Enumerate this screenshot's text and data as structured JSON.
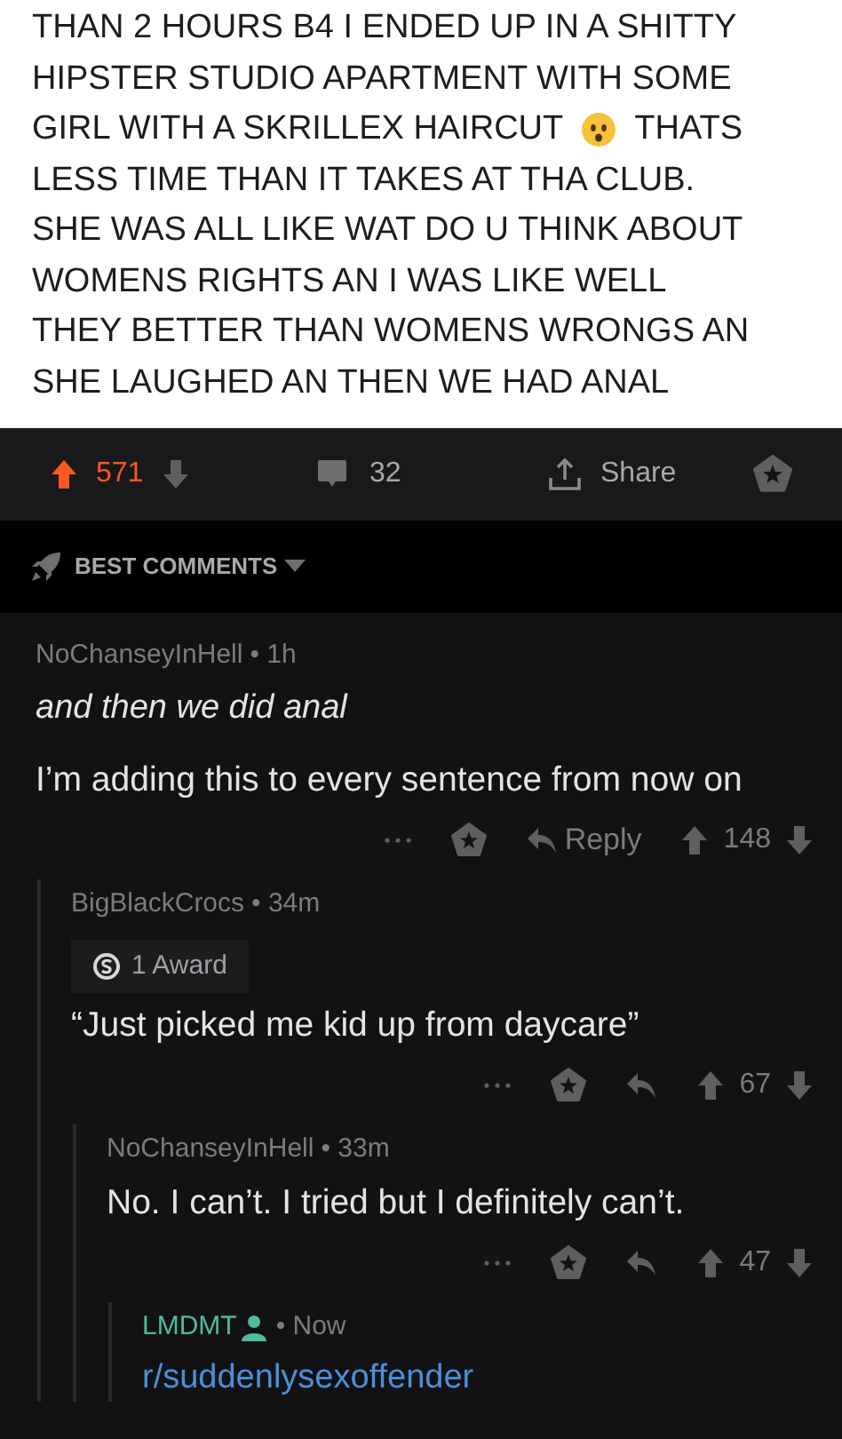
{
  "post_text": [
    {
      "text": "THAN 2 HOURS B4 I ENDED UP IN A SHITTY"
    },
    {
      "text": "HIPSTER STUDIO APARTMENT WITH SOME"
    },
    {
      "text": "GIRL WITH A SKRILLEX HAIRCUT",
      "emoji": true,
      "rest": "THATS"
    },
    {
      "text": "LESS TIME THAN IT TAKES AT THA CLUB."
    },
    {
      "text": "SHE WAS ALL LIKE WAT DO U THINK ABOUT"
    },
    {
      "text": "WOMENS RIGHTS AN I WAS LIKE WELL"
    },
    {
      "text": "THEY BETTER THAN WOMENS WRONGS AN"
    },
    {
      "text": "SHE LAUGHED AN THEN WE HAD ANAL"
    }
  ],
  "post_bar": {
    "score": "571",
    "upvoted": true,
    "comments": "32",
    "share": "Share"
  },
  "sort": {
    "label": "BEST COMMENTS"
  },
  "comments": [
    {
      "author": "NoChanseyInHell",
      "op": false,
      "time": "• 1h",
      "body": [
        {
          "kind": "quote",
          "text": "and then we did anal"
        },
        {
          "kind": "text",
          "text": "I’m adding this to every sentence from now on"
        }
      ],
      "actions": {
        "reply": "Reply",
        "score": "148"
      },
      "children": [
        {
          "author": "BigBlackCrocs",
          "op": false,
          "time": "• 34m",
          "award": "1 Award",
          "body": [
            {
              "kind": "text",
              "text": "“Just picked me kid up from daycare”"
            }
          ],
          "actions": {
            "score": "67"
          },
          "children": [
            {
              "author": "NoChanseyInHell",
              "op": false,
              "time": "• 33m",
              "body": [
                {
                  "kind": "text",
                  "text": "No. I can’t. I tried but I definitely can’t."
                }
              ],
              "actions": {
                "score": "47"
              },
              "children": [
                {
                  "author": "LMDMT",
                  "op": true,
                  "time": "• Now",
                  "body": [
                    {
                      "kind": "link",
                      "text": "r/suddenlysexoffender"
                    }
                  ]
                }
              ]
            }
          ]
        }
      ]
    }
  ]
}
